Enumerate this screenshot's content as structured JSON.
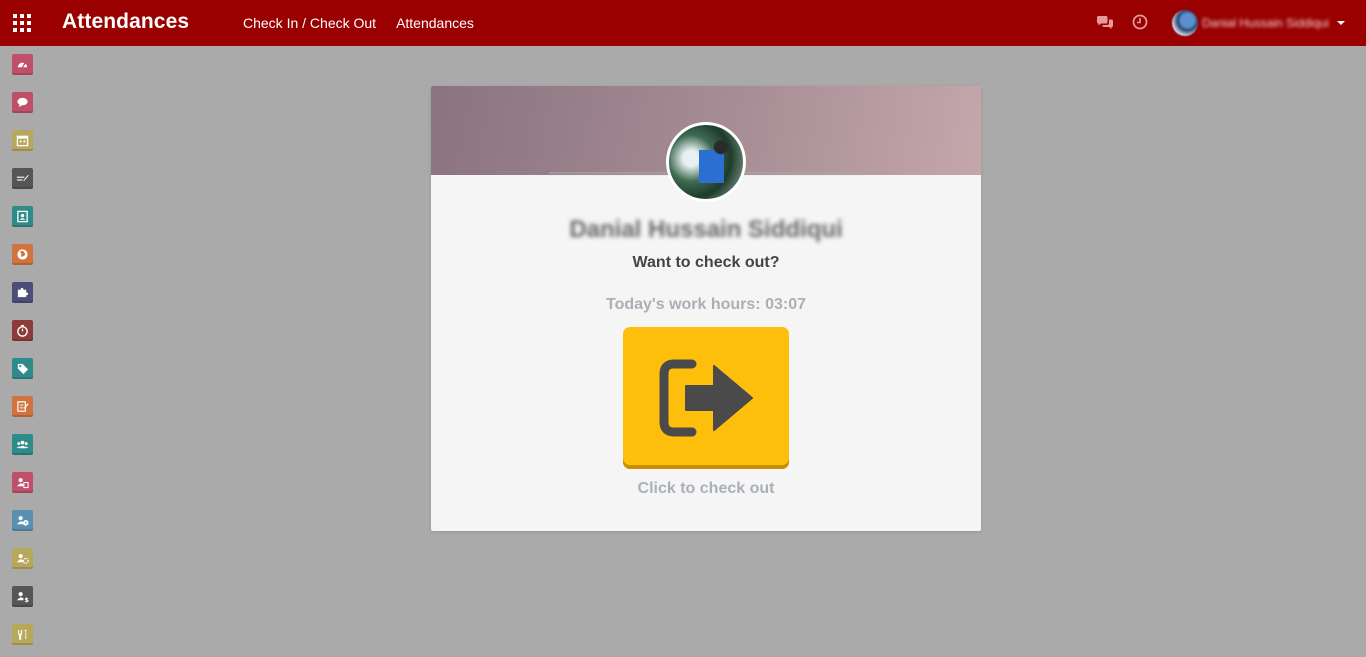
{
  "navbar": {
    "app_title": "Attendances",
    "menu": [
      {
        "label": "Check In / Check Out"
      },
      {
        "label": "Attendances"
      }
    ],
    "icons": [
      "apps-grid-icon",
      "chat-icon",
      "clock-icon"
    ],
    "user_name": "Danial Hussain Siddiqui",
    "background_color": "#9a0000"
  },
  "sidebar": {
    "apps": [
      {
        "icon": "dashboard-icon",
        "color": "#c0506a"
      },
      {
        "icon": "discuss-icon",
        "color": "#c0506a"
      },
      {
        "icon": "calendar-icon",
        "color": "#b8a85c"
      },
      {
        "icon": "notes-icon",
        "color": "#555555"
      },
      {
        "icon": "contacts-icon",
        "color": "#2f8a8a"
      },
      {
        "icon": "website-icon",
        "color": "#d0733e"
      },
      {
        "icon": "apps-puzzle-icon",
        "color": "#4a4f7a"
      },
      {
        "icon": "timer-icon",
        "color": "#8c3a3a"
      },
      {
        "icon": "tag-icon",
        "color": "#2f8a8a"
      },
      {
        "icon": "survey-icon",
        "color": "#d0733e"
      },
      {
        "icon": "team-icon",
        "color": "#2f8a8a"
      },
      {
        "icon": "employee-contract-icon",
        "color": "#c0506a"
      },
      {
        "icon": "employee-clock-icon",
        "color": "#5a8fb0"
      },
      {
        "icon": "employee-settings-icon",
        "color": "#b8a85c"
      },
      {
        "icon": "payroll-icon",
        "color": "#555555"
      },
      {
        "icon": "lunch-icon",
        "color": "#b8a85c"
      }
    ]
  },
  "card": {
    "employee_name": "Danial Hussain Siddiqui",
    "prompt": "Want to check out?",
    "work_hours": "Today's work hours: 03:07",
    "button_icon": "sign-out-icon",
    "button_color": "#fdbe0c",
    "click_hint": "Click to check out"
  }
}
